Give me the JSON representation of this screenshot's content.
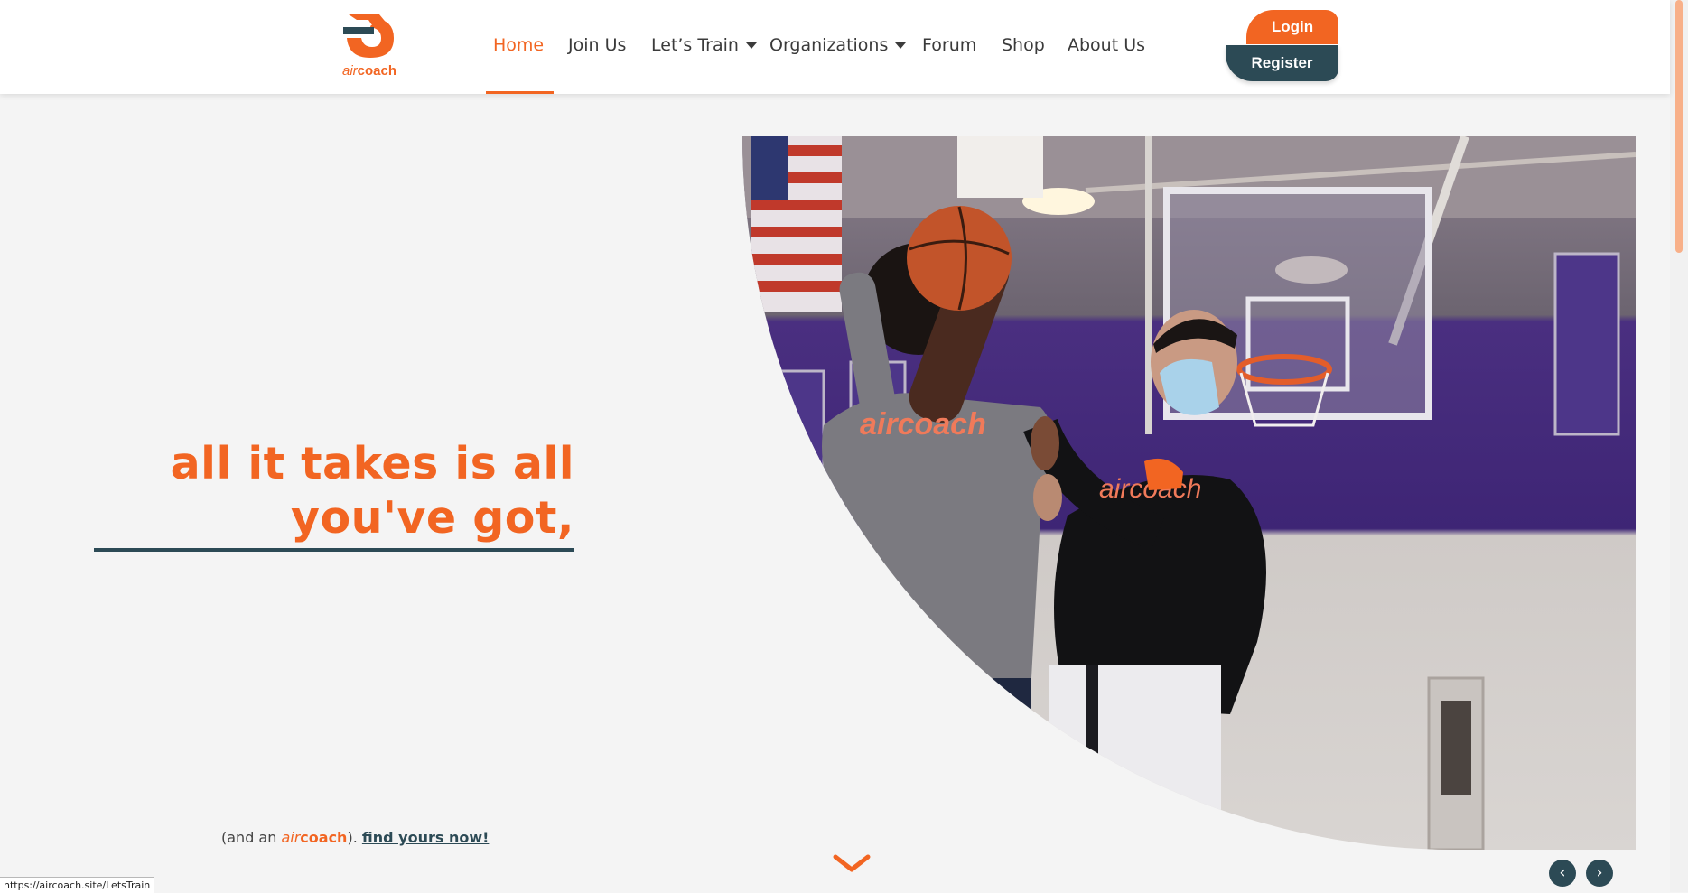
{
  "header": {
    "logo": {
      "air": "air",
      "coach": "coach"
    },
    "nav": [
      {
        "label": "Home",
        "active": true,
        "dropdown": false
      },
      {
        "label": "Join Us",
        "active": false,
        "dropdown": false
      },
      {
        "label": "Let’s Train",
        "active": false,
        "dropdown": true
      },
      {
        "label": "Organizations",
        "active": false,
        "dropdown": true
      },
      {
        "label": "Forum",
        "active": false,
        "dropdown": false
      },
      {
        "label": "Shop",
        "active": false,
        "dropdown": false
      },
      {
        "label": "About Us",
        "active": false,
        "dropdown": false
      }
    ],
    "login_label": "Login",
    "register_label": "Register"
  },
  "hero": {
    "tagline_line1": "all it takes is all",
    "tagline_line2": "you've got,",
    "sub_prefix": "(and an ",
    "sub_air": "air",
    "sub_coach": "coach",
    "sub_mid": "). ",
    "sub_link": "find yours now!",
    "photo_shirt_text_1": "aircoach",
    "photo_shirt_text_2": "aircoach"
  },
  "carousel": {
    "prev": "‹",
    "next": "›"
  },
  "status_bar": {
    "url": "https://aircoach.site/LetsTrain"
  },
  "colors": {
    "accent": "#f26522",
    "dark": "#2c4a55",
    "background": "#f4f4f4"
  }
}
